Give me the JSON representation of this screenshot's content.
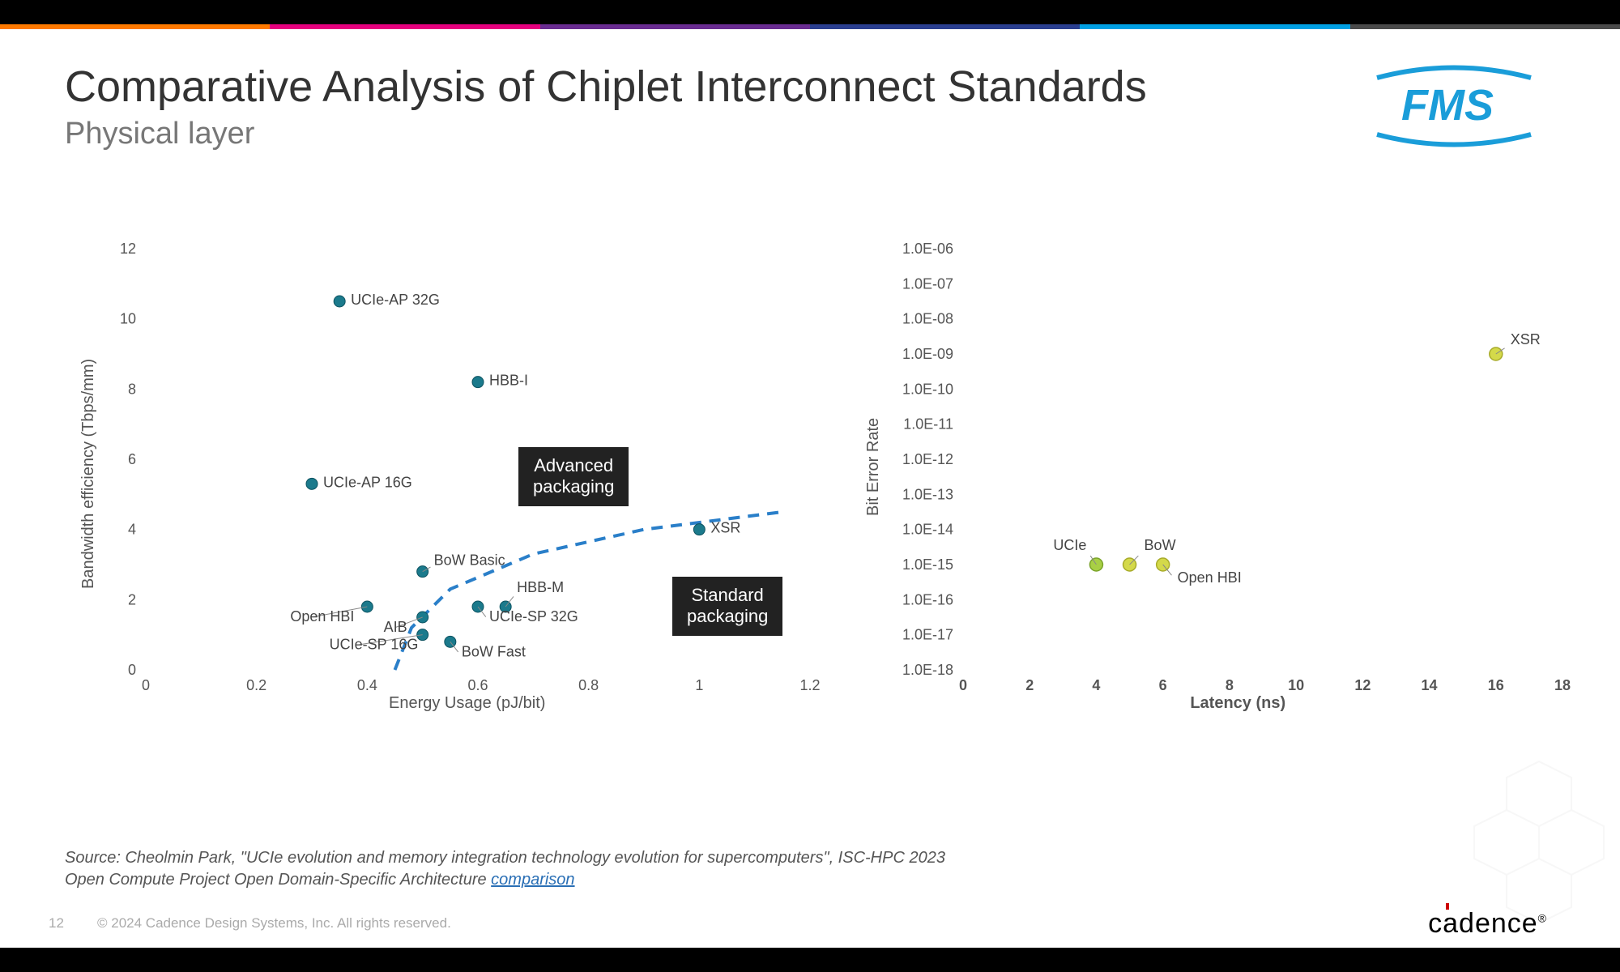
{
  "slide": {
    "title": "Comparative Analysis of Chiplet Interconnect Standards",
    "subtitle": "Physical layer",
    "page_number": "12",
    "copyright": "© 2024 Cadence Design Systems, Inc. All rights reserved.",
    "cadence_logo": "cādence",
    "source_line1": "Source: Cheolmin Park, \"UCIe evolution and memory integration technology evolution for supercomputers\", ISC-HPC 2023",
    "source_line2a": "Open Compute Project Open Domain-Specific Architecture ",
    "source_link": "comparison"
  },
  "chart_data": [
    {
      "type": "scatter",
      "title": "",
      "xlabel": "Energy Usage (pJ/bit)",
      "ylabel": "Bandwidth efficiency (Tbps/mm)",
      "xlim": [
        0,
        1.2
      ],
      "ylim": [
        0,
        12
      ],
      "xticks": [
        0,
        0.2,
        0.4,
        0.6,
        0.8,
        1,
        1.2
      ],
      "yticks": [
        0,
        2,
        4,
        6,
        8,
        10,
        12
      ],
      "callouts": [
        {
          "text": "Advanced\npackaging"
        },
        {
          "text": "Standard\npackaging"
        }
      ],
      "points": [
        {
          "name": "UCIe-AP 32G",
          "x": 0.35,
          "y": 10.5
        },
        {
          "name": "UCIe-AP 16G",
          "x": 0.3,
          "y": 5.3
        },
        {
          "name": "HBB-I",
          "x": 0.6,
          "y": 8.2
        },
        {
          "name": "XSR",
          "x": 1.0,
          "y": 4.0
        },
        {
          "name": "BoW Basic",
          "x": 0.5,
          "y": 2.8
        },
        {
          "name": "HBB-M",
          "x": 0.65,
          "y": 1.8
        },
        {
          "name": "Open HBI",
          "x": 0.4,
          "y": 1.8
        },
        {
          "name": "AIB",
          "x": 0.5,
          "y": 1.5
        },
        {
          "name": "UCIe-SP 32G",
          "x": 0.6,
          "y": 1.8
        },
        {
          "name": "UCIe-SP 16G",
          "x": 0.5,
          "y": 1.0
        },
        {
          "name": "BoW Fast",
          "x": 0.55,
          "y": 0.8
        }
      ],
      "boundary_curve": [
        {
          "x": 0.45,
          "y": 0
        },
        {
          "x": 0.48,
          "y": 1.2
        },
        {
          "x": 0.55,
          "y": 2.3
        },
        {
          "x": 0.7,
          "y": 3.3
        },
        {
          "x": 0.9,
          "y": 4.0
        },
        {
          "x": 1.15,
          "y": 4.5
        }
      ]
    },
    {
      "type": "scatter",
      "title": "",
      "xlabel": "Latency (ns)",
      "ylabel": "Bit Error Rate",
      "xlim": [
        0,
        18
      ],
      "ylim_exp": [
        -18,
        -6
      ],
      "xticks": [
        0,
        2,
        4,
        6,
        8,
        10,
        12,
        14,
        16,
        18
      ],
      "yticks_labels": [
        "1.0E-06",
        "1.0E-07",
        "1.0E-08",
        "1.0E-09",
        "1.0E-10",
        "1.0E-11",
        "1.0E-12",
        "1.0E-13",
        "1.0E-14",
        "1.0E-15",
        "1.0E-16",
        "1.0E-17",
        "1.0E-18"
      ],
      "points": [
        {
          "name": "UCIe",
          "x": 4,
          "y_exp": -15,
          "color": "green"
        },
        {
          "name": "BoW",
          "x": 5,
          "y_exp": -15,
          "color": "yellow"
        },
        {
          "name": "Open HBI",
          "x": 6,
          "y_exp": -15,
          "color": "yellow"
        },
        {
          "name": "XSR",
          "x": 16,
          "y_exp": -9,
          "color": "yellow"
        }
      ]
    }
  ],
  "rainbow_colors": [
    "#ff7a00",
    "#e6007e",
    "#6a2c91",
    "#2a3e8f",
    "#00a0e3",
    "#4a4a4a"
  ]
}
